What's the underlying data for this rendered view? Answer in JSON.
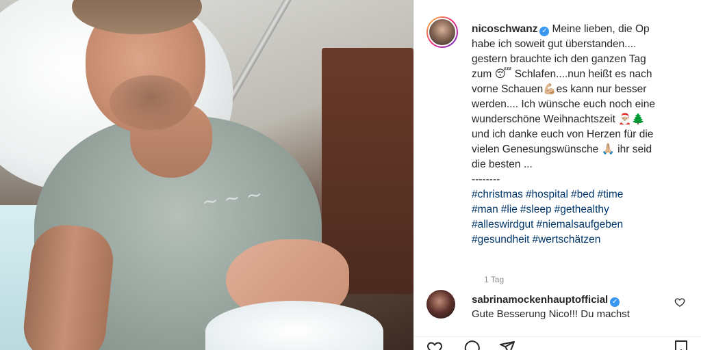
{
  "post": {
    "username": "nicoschwanz",
    "caption_lines": [
      "Meine lieben, die Op",
      "habe ich soweit gut überstanden....",
      "gestern brauchte ich den ganzen Tag",
      "zum 😴 Schlafen....nun heißt es nach",
      "vorne Schauen💪🏼es kann nur besser",
      "werden.... Ich wünsche euch noch eine",
      "wunderschöne Weihnachtszeit 🎅🏼🌲",
      "und ich danke euch von Herzen für die",
      "vielen Genesungswünsche 🙏🏼 ihr seid",
      "die besten ...",
      "--------"
    ],
    "hashtag_lines": [
      [
        "#christmas",
        "#hospital",
        "#bed",
        "#time"
      ],
      [
        "#man",
        "#lie",
        "#sleep",
        "#gethealthy"
      ],
      [
        "#alleswirdgut",
        "#niemalsaufgeben"
      ],
      [
        "#gesundheit",
        "#wertschätzen"
      ]
    ],
    "time_ago": "1 Tag"
  },
  "comment": {
    "username": "sabrinamockenhauptofficial",
    "text": "Gute Besserung Nico!!! Du machst"
  },
  "icons": {
    "verified": "verified-badge-icon",
    "like": "heart-icon",
    "comment": "comment-icon",
    "share": "paper-plane-icon",
    "save": "bookmark-icon"
  },
  "colors": {
    "verified": "#3897f0",
    "hashtag": "#00376b",
    "muted": "#8e8e8e"
  }
}
